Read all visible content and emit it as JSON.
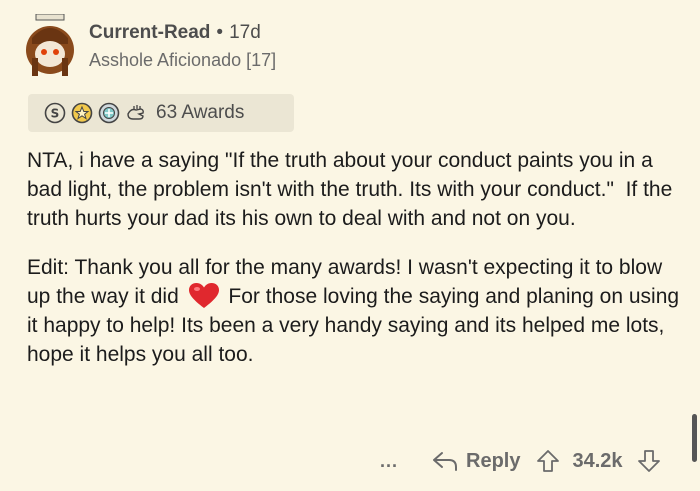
{
  "comment": {
    "username": "Current-Read",
    "separator": "•",
    "age": "17d",
    "flair": "Asshole Aficionado [17]",
    "awards": {
      "icons": [
        "silver-award-icon",
        "gold-award-icon",
        "platinum-award-icon",
        "helpful-hand-award-icon"
      ],
      "count_label": "63 Awards"
    },
    "paragraphs": [
      "NTA, i have a saying \"If the truth about your conduct paints you in a bad light, the problem isn't with the truth. Its with your conduct.\"  If the truth hurts your dad its his own to deal with and not on you."
    ],
    "edit_before_heart": "Edit: Thank you all for the many awards! I wasn't expecting it to blow up the way it did ",
    "edit_after_heart": " For those loving the saying and planing on using it happy to help! Its been a very handy saying and its helped me lots, hope it helps you all too.",
    "heart_color": "#e0282e"
  },
  "footer": {
    "more_label": "...",
    "reply_label": "Reply",
    "score": "34.2k"
  }
}
